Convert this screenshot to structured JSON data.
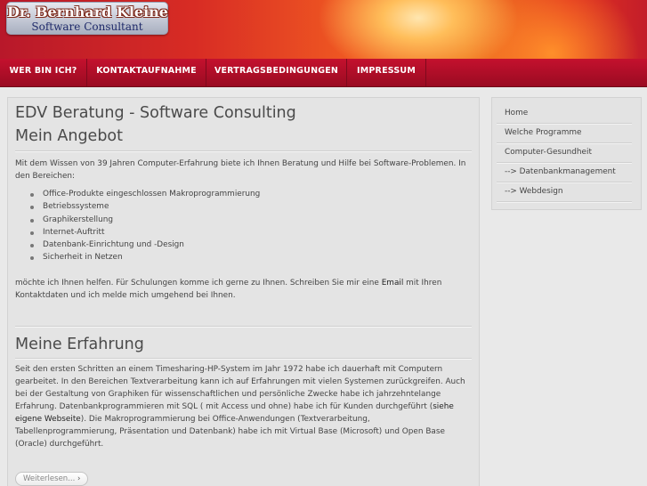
{
  "header": {
    "logo_name": "Dr. Bernhard Kleine",
    "logo_subtitle": "Software Consultant"
  },
  "nav": {
    "items": [
      {
        "label": "WER BIN ICH?"
      },
      {
        "label": "KONTAKTAUFNAHME"
      },
      {
        "label": "VERTRAGSBEDINGUNGEN"
      },
      {
        "label": "IMPRESSUM"
      }
    ]
  },
  "main": {
    "title": "EDV Beratung - Software Consulting",
    "angebot": {
      "heading": "Mein Angebot",
      "intro": "Mit dem Wissen von 39 Jahren Computer-Erfahrung biete ich Ihnen Beratung und Hilfe bei Software-Problemen.  In den Bereichen:",
      "items": [
        "Office-Produkte eingeschlossen Makroprogrammierung",
        "Betriebssysteme",
        "Graphikerstellung",
        "Internet-Auftritt",
        "Datenbank-Einrichtung und -Design",
        "Sicherheit in Netzen"
      ],
      "closing_before": "möchte ich Ihnen helfen. Für Schulungen komme ich gerne zu Ihnen. Schreiben Sie mir eine ",
      "closing_link": "Email",
      "closing_after": " mit Ihren Kontaktdaten und ich melde mich umgehend bei Ihnen."
    },
    "erfahrung": {
      "heading": "Meine Erfahrung",
      "text_before": "Seit den ersten Schritten an einem Timesharing-HP-System im Jahr 1972 habe ich dauerhaft mit Computern gearbeitet. In den Bereichen Textverarbeitung kann ich auf Erfahrungen mit vielen Systemen zurückgreifen. Auch bei der Gestaltung von Graphiken für wissenschaftlichen und persönliche Zwecke habe ich jahrzehntelange Erfahrung. Datenbankprogrammieren mit SQL ( mit Access und ohne) habe ich für Kunden durchgeführt (",
      "text_link": "siehe eigene Webseite",
      "text_after": "). Die Makroprogrammierung bei Office-Anwendungen (Textverarbeitung, Tabellenprogrammierung, Präsentation und Datenbank) habe ich mit Virtual Base (Microsoft) und Open Base (Oracle) durchgeführt."
    },
    "read_more": "Weiterlesen...",
    "read_more_arrow": "›"
  },
  "sidebar": {
    "items": [
      {
        "label": "Home"
      },
      {
        "label": "Welche Programme"
      },
      {
        "label": "Computer-Gesundheit"
      },
      {
        "label": "--> Datenbankmanagement"
      },
      {
        "label": "--> Webdesign"
      }
    ]
  },
  "colors": {
    "nav_bg": "#b30f28",
    "page_bg": "#e9e9e9",
    "panel_bg": "#e4e4e4"
  }
}
